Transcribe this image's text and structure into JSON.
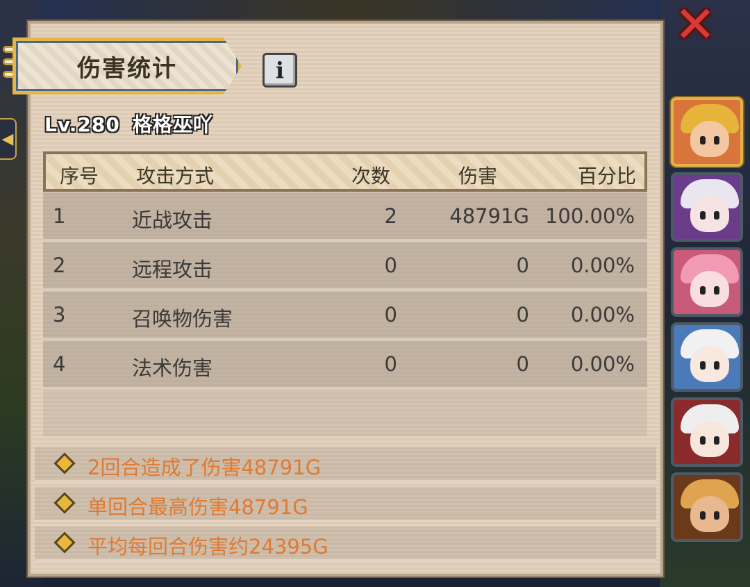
{
  "dialog": {
    "title": "伤害统计",
    "info_icon": "info-icon",
    "close_icon": "close-icon",
    "player_level": "Lv.280",
    "player_name": "格格巫吖"
  },
  "table": {
    "headers": {
      "no": "序号",
      "type": "攻击方式",
      "count": "次数",
      "damage": "伤害",
      "percent": "百分比"
    },
    "rows": [
      {
        "no": "1",
        "type": "近战攻击",
        "count": "2",
        "damage": "48791G",
        "percent": "100.00%"
      },
      {
        "no": "2",
        "type": "远程攻击",
        "count": "0",
        "damage": "0",
        "percent": "0.00%"
      },
      {
        "no": "3",
        "type": "召唤物伤害",
        "count": "0",
        "damage": "0",
        "percent": "0.00%"
      },
      {
        "no": "4",
        "type": "法术伤害",
        "count": "0",
        "damage": "0",
        "percent": "0.00%"
      }
    ]
  },
  "summary": [
    "2回合造成了伤害48791G",
    "单回合最高伤害48791G",
    "平均每回合伤害约24395G"
  ],
  "heroes": [
    {
      "icon": "hero-portrait-icon",
      "selected": true,
      "bg": "#d9743a",
      "hair": "#e7b43a",
      "skin": "#f2c7a2"
    },
    {
      "icon": "hero-portrait-icon",
      "selected": false,
      "bg": "#6a3c8a",
      "hair": "#e9e6f0",
      "skin": "#f6e3e3"
    },
    {
      "icon": "hero-portrait-icon",
      "selected": false,
      "bg": "#c85a7a",
      "hair": "#f29ab4",
      "skin": "#f8dede"
    },
    {
      "icon": "hero-portrait-icon",
      "selected": false,
      "bg": "#4a7ab8",
      "hair": "#f1f1f4",
      "skin": "#f7e8e0"
    },
    {
      "icon": "hero-portrait-icon",
      "selected": false,
      "bg": "#8a2a2a",
      "hair": "#efeeee",
      "skin": "#f6e6dc"
    },
    {
      "icon": "hero-portrait-icon",
      "selected": false,
      "bg": "#6a3a1a",
      "hair": "#e0a450",
      "skin": "#e8b890"
    }
  ],
  "colors": {
    "summary_text": "#e07a32",
    "accent_gold": "#e3b54a",
    "close_red": "#d83a3a"
  }
}
